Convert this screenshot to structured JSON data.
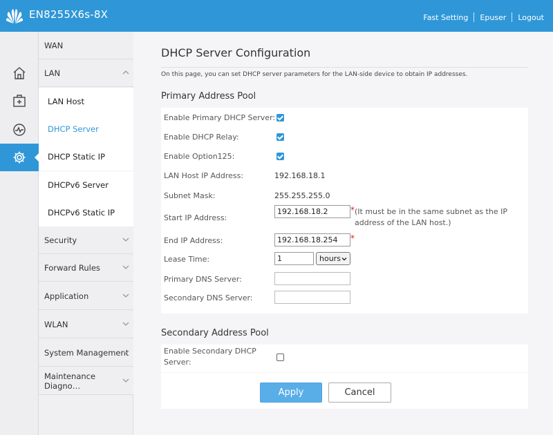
{
  "header": {
    "brand": "EN8255X6s-8X",
    "links": [
      "Fast Setting",
      "Epuser",
      "Logout"
    ]
  },
  "rail": [
    {
      "icon": "home-icon"
    },
    {
      "icon": "first-aid-icon"
    },
    {
      "icon": "pulse-icon"
    },
    {
      "icon": "gear-icon",
      "active": true
    }
  ],
  "menu": {
    "wan": "WAN",
    "lan": "LAN",
    "lan_items": [
      "LAN Host",
      "DHCP Server",
      "DHCP Static IP",
      "DHCPv6 Server",
      "DHCPv6 Static IP"
    ],
    "security": "Security",
    "forward_rules": "Forward Rules",
    "application": "Application",
    "wlan": "WLAN",
    "system_management": "System Management",
    "maintenance": "Maintenance Diagno…"
  },
  "page": {
    "title": "DHCP Server Configuration",
    "description": "On this page, you can set DHCP server parameters for the LAN-side device to obtain IP addresses."
  },
  "primary": {
    "title": "Primary Address Pool",
    "enable_server_label": "Enable Primary DHCP Server:",
    "enable_relay_label": "Enable DHCP Relay:",
    "enable_option125_label": "Enable Option125:",
    "lan_ip_label": "LAN Host IP Address:",
    "lan_ip_value": "192.168.18.1",
    "subnet_label": "Subnet Mask:",
    "subnet_value": "255.255.255.0",
    "start_ip_label": "Start IP Address:",
    "start_ip_value": "192.168.18.2",
    "start_ip_note": "(It must be in the same subnet as the IP address of the LAN host.)",
    "end_ip_label": "End IP Address:",
    "end_ip_value": "192.168.18.254",
    "lease_label": "Lease Time:",
    "lease_value": "1",
    "lease_unit": "hours",
    "primary_dns_label": "Primary DNS Server:",
    "primary_dns_value": "",
    "secondary_dns_label": "Secondary DNS Server:",
    "secondary_dns_value": "",
    "required_mark": "*"
  },
  "secondary": {
    "title": "Secondary Address Pool",
    "enable_label": "Enable Secondary DHCP Server:"
  },
  "buttons": {
    "apply": "Apply",
    "cancel": "Cancel"
  },
  "colors": {
    "accent": "#2f97d8",
    "apply_button": "#5aaee8",
    "required": "#e02020"
  }
}
